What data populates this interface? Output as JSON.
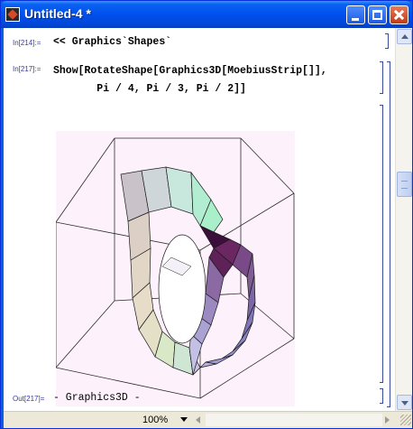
{
  "window": {
    "title": "Untitled-4 *"
  },
  "cells": [
    {
      "label": "In[214]:=",
      "input": "<< Graphics`Shapes`"
    },
    {
      "label": "In[217]:=",
      "input": "Show[RotateShape[Graphics3D[MoebiusStrip[]],\n       Pi / 4, Pi / 3, Pi / 2]]"
    },
    {
      "label": "Out[217]=",
      "output": "- Graphics3D -"
    }
  ],
  "graphic": {
    "content": "Moebius strip 3D rendering",
    "background": "#fdf2fb"
  },
  "statusbar": {
    "zoom": "100%"
  },
  "colors": {
    "titlebar": "#0050ee",
    "bracket": "#3a4a9a",
    "label": "#3a3aa0"
  }
}
